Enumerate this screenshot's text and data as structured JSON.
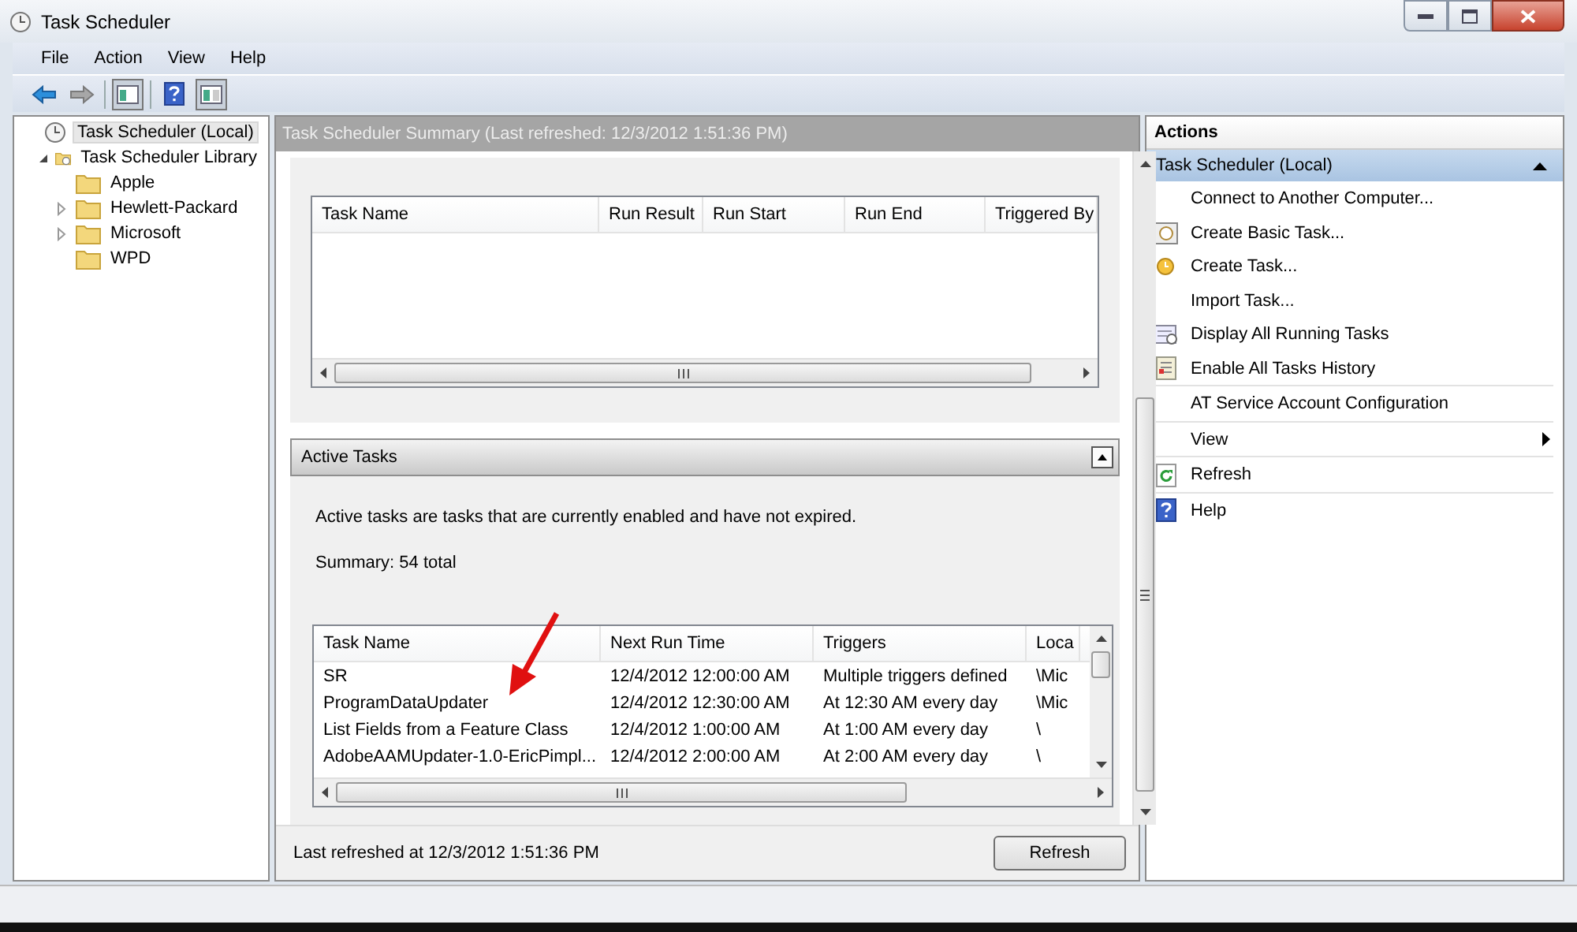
{
  "window": {
    "title": "Task Scheduler"
  },
  "menu": [
    "File",
    "Action",
    "View",
    "Help"
  ],
  "toolbar": [
    {
      "kind": "back",
      "pressed": false
    },
    {
      "kind": "forward",
      "pressed": false
    },
    {
      "kind": "console-tree",
      "pressed": true
    },
    {
      "kind": "help",
      "pressed": false
    },
    {
      "kind": "action-pane",
      "pressed": true
    }
  ],
  "tree": [
    {
      "label": "Task Scheduler (Local)",
      "kind": "clock",
      "selected": true,
      "children": [
        {
          "label": "Task Scheduler Library",
          "kind": "library",
          "selected": false,
          "expanded": true,
          "children": [
            {
              "label": "Apple",
              "kind": "folder",
              "selected": false
            },
            {
              "label": "Hewlett-Packard",
              "kind": "folder",
              "selected": false,
              "expanded": false
            },
            {
              "label": "Microsoft",
              "kind": "folder",
              "selected": false,
              "expanded": false
            },
            {
              "label": "WPD",
              "kind": "folder",
              "selected": false
            }
          ]
        }
      ]
    }
  ],
  "summary": {
    "title": "Task Scheduler Summary (Last refreshed: 12/3/2012 1:51:36 PM)",
    "status_table": {
      "columns": [
        "Task Name",
        "Run Result",
        "Run Start",
        "Run End",
        "Triggered By"
      ]
    },
    "active_tasks": {
      "title": "Active Tasks",
      "expanded": true,
      "description": "Active tasks are tasks that are currently enabled and have not expired.",
      "summary": "Summary: 54 total",
      "columns": [
        "Task Name",
        "Next Run Time",
        "Triggers",
        "Loca"
      ],
      "rows": [
        [
          "SR",
          "12/4/2012 12:00:00 AM",
          "Multiple triggers defined",
          "\\Mic"
        ],
        [
          "ProgramDataUpdater",
          "12/4/2012 12:30:00 AM",
          "At 12:30 AM every day",
          "\\Mic"
        ],
        [
          "List Fields from a Feature Class",
          "12/4/2012 1:00:00 AM",
          "At 1:00 AM every day",
          "\\"
        ],
        [
          "AdobeAAMUpdater-1.0-EricPimpl...",
          "12/4/2012 2:00:00 AM",
          "At 2:00 AM every day",
          "\\"
        ]
      ]
    },
    "last_refreshed": "Last refreshed at 12/3/2012 1:51:36 PM",
    "refresh_button": "Refresh"
  },
  "actions": {
    "title": "Actions",
    "section": "Task Scheduler (Local)",
    "expanded": true,
    "groups": [
      [
        {
          "label": "Connect to Another Computer...",
          "kind": "plain"
        },
        {
          "label": "Create Basic Task...",
          "kind": "basic-task"
        },
        {
          "label": "Create Task...",
          "kind": "task"
        },
        {
          "label": "Import Task...",
          "kind": "plain"
        },
        {
          "label": "Display All Running Tasks",
          "kind": "running"
        },
        {
          "label": "Enable All Tasks History",
          "kind": "history"
        }
      ],
      [
        {
          "label": "AT Service Account Configuration",
          "kind": "plain"
        }
      ],
      [
        {
          "label": "View",
          "kind": "submenu"
        }
      ],
      [
        {
          "label": "Refresh",
          "kind": "refresh"
        }
      ],
      [
        {
          "label": "Help",
          "kind": "help"
        }
      ]
    ]
  }
}
